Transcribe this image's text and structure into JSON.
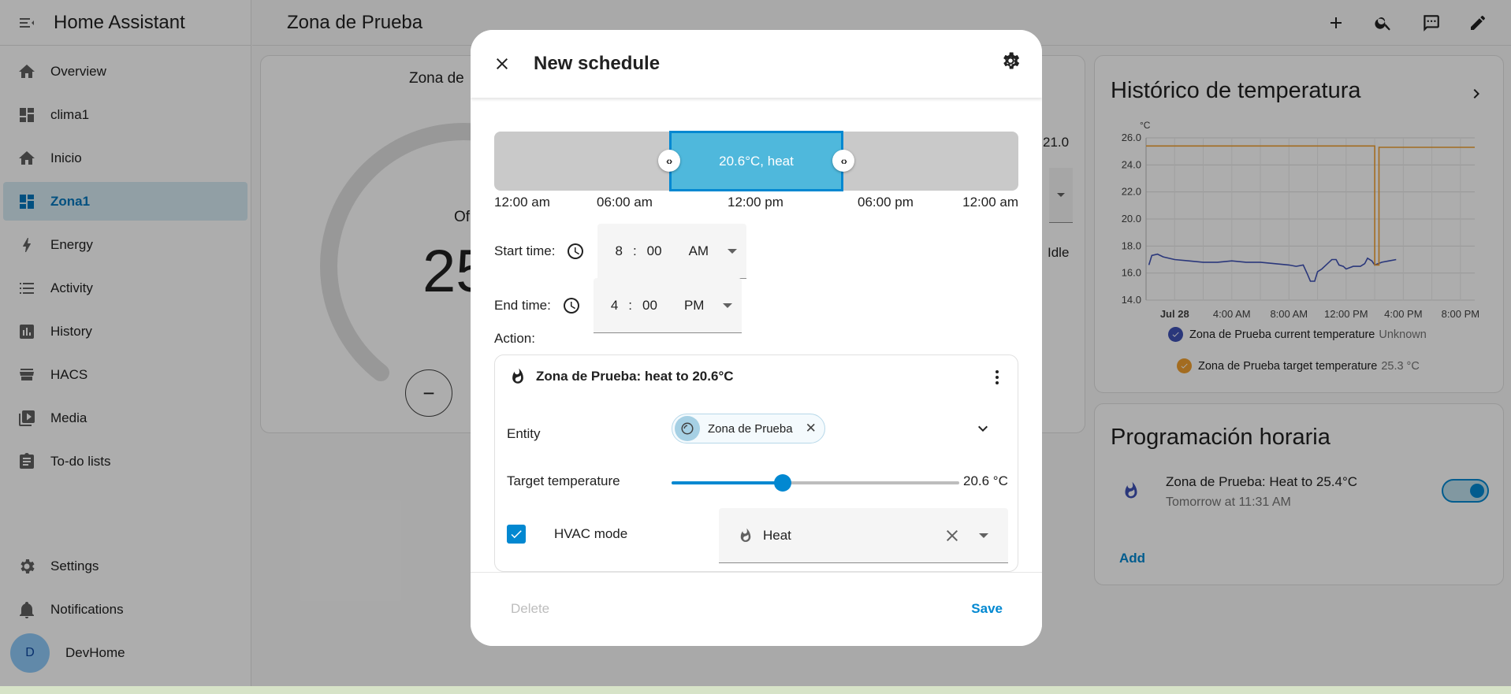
{
  "app": {
    "title": "Home Assistant",
    "page_title": "Zona de Prueba"
  },
  "sidebar": {
    "items": [
      {
        "label": "Overview",
        "icon": "home-icon"
      },
      {
        "label": "clima1",
        "icon": "dashboard-icon"
      },
      {
        "label": "Inicio",
        "icon": "home-icon"
      },
      {
        "label": "Zona1",
        "icon": "dashboard-icon",
        "active": true
      },
      {
        "label": "Energy",
        "icon": "lightning-icon"
      },
      {
        "label": "Activity",
        "icon": "list-icon"
      },
      {
        "label": "History",
        "icon": "chart-box-icon"
      },
      {
        "label": "HACS",
        "icon": "hacs-store-icon"
      },
      {
        "label": "Media",
        "icon": "media-play-icon"
      },
      {
        "label": "To-do lists",
        "icon": "clipboard-list-icon"
      }
    ],
    "settings_label": "Settings",
    "notifications_label": "Notifications",
    "user": {
      "initial": "D",
      "name": "DevHome"
    }
  },
  "thermostat_card": {
    "name_partial": "Zona de",
    "mode_partial": "Of",
    "temp_partial": "25",
    "side_value": "21.0",
    "side_status": "Idle",
    "minus_label": "−"
  },
  "history_card": {
    "title": "Histórico de temperatura",
    "legend": [
      {
        "label": "Zona de Prueba current temperature",
        "value": "Unknown",
        "color": "#3f51b5"
      },
      {
        "label": "Zona de Prueba target temperature",
        "value": "25.3 °C",
        "color": "#f0a030"
      }
    ]
  },
  "chart_data": {
    "type": "line",
    "unit_label": "°C",
    "x_ticks": [
      "Jul 28",
      "4:00 AM",
      "8:00 AM",
      "12:00 PM",
      "4:00 PM",
      "8:00 PM"
    ],
    "y_ticks": [
      "26.0",
      "24.0",
      "22.0",
      "20.0",
      "18.0",
      "16.0",
      "14.0"
    ],
    "ylim": [
      14.0,
      26.0
    ],
    "x_range_hours": [
      -2,
      21
    ],
    "grid": true,
    "series": [
      {
        "name": "Zona de Prueba current temperature",
        "color": "#3f51b5",
        "points": [
          [
            -1.8,
            16.6
          ],
          [
            -1.6,
            17.3
          ],
          [
            -1.2,
            17.4
          ],
          [
            -0.8,
            17.2
          ],
          [
            0,
            17.0
          ],
          [
            1,
            16.9
          ],
          [
            2,
            16.8
          ],
          [
            3,
            16.8
          ],
          [
            4,
            16.9
          ],
          [
            5,
            16.8
          ],
          [
            6,
            16.8
          ],
          [
            7,
            16.7
          ],
          [
            8,
            16.6
          ],
          [
            8.5,
            16.5
          ],
          [
            9,
            16.6
          ],
          [
            9.3,
            15.9
          ],
          [
            9.5,
            15.4
          ],
          [
            9.8,
            15.4
          ],
          [
            10,
            16.1
          ],
          [
            10.3,
            16.3
          ],
          [
            10.5,
            16.5
          ],
          [
            10.8,
            16.8
          ],
          [
            11,
            17.0
          ],
          [
            11.3,
            17.0
          ],
          [
            11.5,
            16.6
          ],
          [
            11.8,
            16.5
          ],
          [
            12,
            16.3
          ],
          [
            12.5,
            16.5
          ],
          [
            13,
            16.5
          ],
          [
            13.3,
            16.7
          ],
          [
            13.5,
            17.1
          ],
          [
            13.8,
            16.9
          ],
          [
            14,
            16.6
          ],
          [
            14.5,
            16.8
          ],
          [
            15,
            16.9
          ],
          [
            15.5,
            17.0
          ]
        ]
      },
      {
        "name": "Zona de Prueba target temperature",
        "color": "#f0a030",
        "points": [
          [
            -2,
            25.4
          ],
          [
            14,
            25.4
          ],
          [
            14,
            16.6
          ],
          [
            14.3,
            16.6
          ],
          [
            14.3,
            25.3
          ],
          [
            21,
            25.3
          ]
        ]
      }
    ]
  },
  "schedule_card": {
    "title": "Programación horaria",
    "item_title": "Zona de Prueba: Heat to 25.4°C",
    "item_subtitle": "Tomorrow at 11:31 AM",
    "toggle_on": true,
    "add_label": "Add"
  },
  "dialog": {
    "title": "New schedule",
    "timeline": {
      "segment_label": "20.6°C, heat",
      "segment_start_hour": 8,
      "segment_end_hour": 16,
      "labels": [
        "12:00 am",
        "06:00 am",
        "12:00 pm",
        "06:00 pm",
        "12:00 am"
      ],
      "left_handle": "‹›",
      "right_handle": "‹›"
    },
    "start_time": {
      "label": "Start time:",
      "hour": "8",
      "sep": ":",
      "minute": "00",
      "ampm": "AM"
    },
    "end_time": {
      "label": "End time:",
      "hour": "4",
      "sep": ":",
      "minute": "00",
      "ampm": "PM"
    },
    "action_label": "Action:",
    "action": {
      "title": "Zona de Prueba: heat to 20.6°C",
      "entity_label": "Entity",
      "entity_chip": "Zona de Prueba",
      "chip_remove": "✕",
      "target_label": "Target temperature",
      "target_value": "20.6 °C",
      "target_fraction": 0.385,
      "hvac_label": "HVAC mode",
      "hvac_checked": true,
      "hvac_value": "Heat"
    },
    "delete_label": "Delete",
    "save_label": "Save"
  }
}
